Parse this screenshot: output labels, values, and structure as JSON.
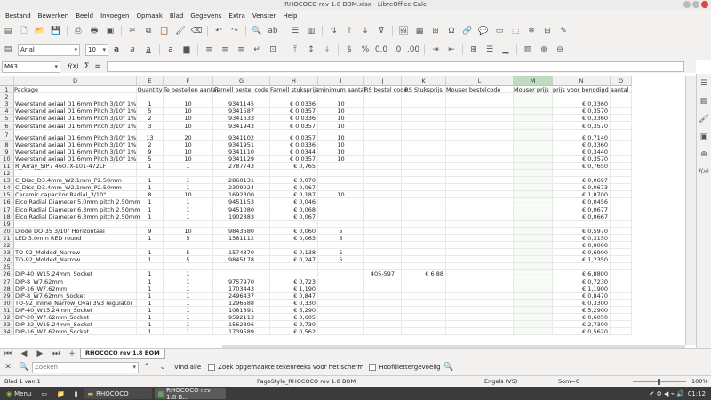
{
  "window": {
    "title": "RHOCOCO rev 1.8 BOM.xlsx - LibreOffice Calc"
  },
  "menu": [
    "Bestand",
    "Bewerken",
    "Beeld",
    "Invoegen",
    "Opmaak",
    "Blad",
    "Gegevens",
    "Extra",
    "Venster",
    "Help"
  ],
  "toolbar": {
    "font_name": "Arial",
    "font_size": "10"
  },
  "formula_bar": {
    "name_box": "M63",
    "fx_label": "f(X)",
    "sum_label": "Σ",
    "eq_label": "="
  },
  "columns": [
    "D",
    "E",
    "F",
    "G",
    "H",
    "I",
    "J",
    "K",
    "L",
    "M",
    "N",
    "O"
  ],
  "rows": [
    {
      "n": "1",
      "D": "Package",
      "E": "Quantity",
      "F": "Te bestellen aantal",
      "G": "Farnell  bestel code",
      "H": "Farnell stuksprijs",
      "I": "minimum aantal",
      "J": "RS bestel code",
      "K": "RS Stuksprijs",
      "L": "Mouser bestelcode",
      "M": "Mouser prijs",
      "N": "prijs voor benodigd aantal",
      "O": ""
    },
    {
      "n": "2"
    },
    {
      "n": "3",
      "D": "Weerstand axiaal D1.6mm Pitch 3/10\" 1%",
      "E": "1",
      "F": "10",
      "G": "9341145",
      "H": "€ 0,0336",
      "I": "10",
      "N": "€ 0,3360"
    },
    {
      "n": "4",
      "D": "Weerstand axiaal D1.6mm Pitch 3/10\" 1%",
      "E": "5",
      "F": "10",
      "G": "9341587",
      "H": "€ 0,0357",
      "I": "10",
      "N": "€ 0,3570"
    },
    {
      "n": "5",
      "D": "Weerstand axiaal D1.6mm Pitch 3/10\" 1%",
      "E": "2",
      "F": "10",
      "G": "9341633",
      "H": "€ 0,0336",
      "I": "10",
      "N": "€ 0,3360"
    },
    {
      "n": "6",
      "D": "Weerstand axiaal D1.6mm Pitch 3/10\" 1%",
      "E": "3",
      "F": "10",
      "G": "9341943",
      "H": "€ 0,0357",
      "I": "10",
      "N": "€ 0,3570"
    },
    {
      "n": "7",
      "D": "Weerstand axiaal D1.6mm Pitch 3/10\" 1%",
      "E": "13",
      "F": "20",
      "G": "9341102",
      "H": "€ 0,0357",
      "I": "10",
      "N": "€ 0,7140",
      "tall": true
    },
    {
      "n": "8",
      "D": "Weerstand axiaal D1.6mm Pitch 3/10\" 1%",
      "E": "2",
      "F": "10",
      "G": "9341951",
      "H": "€ 0,0336",
      "I": "10",
      "N": "€ 0,3360"
    },
    {
      "n": "9",
      "D": "Weerstand axiaal D1.6mm Pitch 3/10\" 1%",
      "E": "9",
      "F": "10",
      "G": "9341110",
      "H": "€ 0,0344",
      "I": "10",
      "N": "€ 0,3440"
    },
    {
      "n": "10",
      "D": "Weerstand axiaal D1.6mm Pitch 3/10\" 1%",
      "E": "5",
      "F": "10",
      "G": "9341129",
      "H": "€ 0,0357",
      "I": "10",
      "N": "€ 0,3570"
    },
    {
      "n": "11",
      "D": "R_Array_SIP7 4607X-101-472LF",
      "E": "1",
      "F": "1",
      "G": "2787743",
      "H": "€ 0,765",
      "N": "€ 0,7650"
    },
    {
      "n": "12"
    },
    {
      "n": "13",
      "D": "C_Disc_D3.4mm_W2.1mm_P2.50mm",
      "E": "1",
      "F": "1",
      "G": "2860131",
      "H": "€ 0,070",
      "N": "€ 0,0697"
    },
    {
      "n": "14",
      "D": "C_Disc_D3.4mm_W2.1mm_P2.50mm",
      "E": "1",
      "F": "1",
      "G": "2309024",
      "H": "€ 0,067",
      "N": "€ 0,0673"
    },
    {
      "n": "15",
      "D": "Ceramic capacitor Radial_3/10\"",
      "E": "8",
      "F": "10",
      "G": "1692300",
      "H": "€ 0,187",
      "I": "10",
      "N": "€ 1,8700"
    },
    {
      "n": "16",
      "D": "Elco Radial Diameter 5.0mm pitch 2.50mm",
      "E": "1",
      "F": "1",
      "G": "9451153",
      "H": "€ 0,046",
      "N": "€ 0,0456"
    },
    {
      "n": "17",
      "D": "Elco Radial Diameter 6.3mm pitch 2.50mm",
      "E": "1",
      "F": "1",
      "G": "9451080",
      "H": "€ 0,068",
      "N": "€ 0,0677"
    },
    {
      "n": "18",
      "D": "Elco Radial Diameter 6.3mm pitch 2.50mm",
      "E": "1",
      "F": "1",
      "G": "1902883",
      "H": "€ 0,067",
      "N": "€ 0,0667"
    },
    {
      "n": "19"
    },
    {
      "n": "20",
      "D": "Diode DO-35  3/10\" Horizontaal",
      "E": "9",
      "F": "10",
      "G": "9843680",
      "H": "€ 0,060",
      "I": "5",
      "N": "€ 0,5970"
    },
    {
      "n": "21",
      "D": "LED 3.0mm RED round",
      "E": "1",
      "F": "5",
      "G": "1581112",
      "H": "€ 0,063",
      "I": "5",
      "N": "€ 0,3150"
    },
    {
      "n": "22",
      "N": "€ 0,0000"
    },
    {
      "n": "23",
      "D": "TO-92_Molded_Narrow",
      "E": "1",
      "F": "5",
      "G": "1574370",
      "H": "€ 0,138",
      "I": "5",
      "N": "€ 0,6900"
    },
    {
      "n": "24",
      "D": "TO-92_Molded_Narrow",
      "E": "1",
      "F": "5",
      "G": "9845178",
      "H": "€ 0,247",
      "I": "5",
      "N": "€ 1,2350"
    },
    {
      "n": "25"
    },
    {
      "n": "26",
      "D": "DIP-40_W15.24mm_Socket",
      "E": "1",
      "F": "1",
      "J": "405-597",
      "K": "€ 6,88",
      "N": "€ 6,8800"
    },
    {
      "n": "27",
      "D": "DIP-8_W7.62mm",
      "E": "1",
      "F": "1",
      "G": "9757970",
      "H": "€ 0,723",
      "N": "€ 0,7230"
    },
    {
      "n": "28",
      "D": "DIP-16_W7.62mm",
      "E": "1",
      "F": "1",
      "G": "1703443",
      "H": "€ 1,190",
      "N": "€ 1,1900"
    },
    {
      "n": "29",
      "D": "DIP-8_W7.62mm_Socket",
      "E": "1",
      "F": "1",
      "G": "2496437",
      "H": "€ 0,847",
      "N": "€ 0,8470"
    },
    {
      "n": "30",
      "D": "TO-92_Inline_Narrow_Oval 3V3 regulator",
      "E": "1",
      "F": "1",
      "G": "1296588",
      "H": "€ 0,330",
      "N": "€ 0,3300"
    },
    {
      "n": "31",
      "D": "DIP-40_W15.24mm_Socket",
      "E": "1",
      "F": "1",
      "G": "1081891",
      "H": "€ 5,290",
      "N": "€ 5,2900"
    },
    {
      "n": "32",
      "D": "DIP-20_W7.62mm_Socket",
      "E": "1",
      "F": "1",
      "G": "9592113",
      "H": "€ 0,605",
      "N": "€ 0,6050"
    },
    {
      "n": "33",
      "D": "DIP-32_W15.24mm_Socket",
      "E": "1",
      "F": "1",
      "G": "1562896",
      "H": "€ 2,730",
      "N": "€ 2,7300"
    },
    {
      "n": "34",
      "D": "DIP-16_W7.62mm_Socket",
      "E": "1",
      "F": "1",
      "G": "1739589",
      "H": "€ 0,562",
      "N": "€ 0,5620"
    }
  ],
  "sheet_tab": "RHOCOCO rev 1.8 BOM",
  "find": {
    "placeholder": "Zoeken",
    "find_all": "Vind alle",
    "option1": "Zoek opgemaakte tekenreeks voor het scherm",
    "option2": "Hoofdlettergevoelig"
  },
  "status": {
    "sheet": "Blad 1 van 1",
    "style": "PageStyle_RHOCOCO rev 1.8 BOM",
    "lang": "Engels (VS)",
    "sum": "Som=0",
    "zoom": "100%"
  },
  "taskbar": {
    "menu": "Menu",
    "item1": "RHOCOCO",
    "item2": "RHOCOCO rev 1.8 B...",
    "clock": "01:12"
  },
  "colors": {
    "selected_col": "#c0dcc0",
    "accent": "#1e6fc6"
  }
}
